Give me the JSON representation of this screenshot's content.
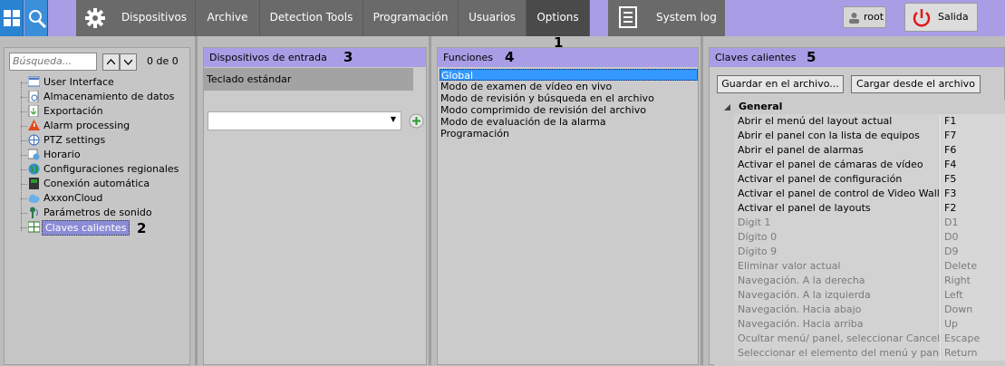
{
  "topbar": {
    "menu": [
      {
        "label": "Dispositivos",
        "active": false
      },
      {
        "label": "Archive",
        "active": false
      },
      {
        "label": "Detection Tools",
        "active": false
      },
      {
        "label": "Programación",
        "active": false
      },
      {
        "label": "Usuarios",
        "active": false
      },
      {
        "label": "Options",
        "active": true
      }
    ],
    "system_log": "System log",
    "user": "root",
    "exit": "Salida",
    "icons": [
      "layout-grid-icon",
      "search-icon",
      "gear-icon",
      "document-log-icon",
      "user-icon",
      "power-icon"
    ],
    "accent": "#a99de6"
  },
  "markers": [
    "1",
    "2",
    "3",
    "4",
    "5"
  ],
  "tree": {
    "search_placeholder": "Búsqueda...",
    "count": "0 de 0",
    "items": [
      {
        "label": "User Interface",
        "icon": "user-interface-icon"
      },
      {
        "label": "Almacenamiento de datos",
        "icon": "storage-icon"
      },
      {
        "label": "Exportación",
        "icon": "export-icon"
      },
      {
        "label": "Alarm processing",
        "icon": "alarm-icon"
      },
      {
        "label": "PTZ settings",
        "icon": "ptz-icon"
      },
      {
        "label": "Horario",
        "icon": "schedule-icon"
      },
      {
        "label": "Configuraciones regionales",
        "icon": "globe-icon"
      },
      {
        "label": "Conexión automática",
        "icon": "auto-connect-icon"
      },
      {
        "label": "AxxonCloud",
        "icon": "cloud-icon"
      },
      {
        "label": "Parámetros de sonido",
        "icon": "sound-icon"
      },
      {
        "label": "Claves calientes",
        "icon": "hotkeys-icon",
        "selected": true
      }
    ]
  },
  "devices": {
    "title": "Dispositivos de entrada",
    "item": "Teclado estándar",
    "select_value": ""
  },
  "functions": {
    "title": "Funciones",
    "items": [
      "Global",
      "Modo de examen de vídeo en vivo",
      "Modo de revisión y búsqueda en el archivo",
      "Modo comprimido de revisión del archivo",
      "Modo de evaluación de la alarma",
      "Programación"
    ]
  },
  "keys": {
    "title": "Claves calientes",
    "save_label": "Guardar en el archivo...",
    "load_label": "Cargar desde el archivo",
    "group": "General",
    "rows": [
      {
        "name": "Abrir el menú del layout actual",
        "key": "F1",
        "dim": false
      },
      {
        "name": "Abrir el panel con la lista de equipos",
        "key": "F7",
        "dim": false
      },
      {
        "name": "Abrir el panel de alarmas",
        "key": "F6",
        "dim": false
      },
      {
        "name": "Activar el panel de cámaras de vídeo",
        "key": "F4",
        "dim": false
      },
      {
        "name": "Activar el panel de configuración",
        "key": "F5",
        "dim": false
      },
      {
        "name": "Activar el panel de control de Video Wall",
        "key": "F3",
        "dim": false
      },
      {
        "name": "Activar el panel de layouts",
        "key": "F2",
        "dim": false
      },
      {
        "name": "Digit 1",
        "key": "D1",
        "dim": true
      },
      {
        "name": "Dígito 0",
        "key": "D0",
        "dim": true
      },
      {
        "name": "Dígito 9",
        "key": "D9",
        "dim": true
      },
      {
        "name": "Eliminar valor actual",
        "key": "Delete",
        "dim": true
      },
      {
        "name": "Navegación. A la derecha",
        "key": "Right",
        "dim": true
      },
      {
        "name": "Navegación. A la izquierda",
        "key": "Left",
        "dim": true
      },
      {
        "name": "Navegación. Hacia abajo",
        "key": "Down",
        "dim": true
      },
      {
        "name": "Navegación. Hacia arriba",
        "key": "Up",
        "dim": true
      },
      {
        "name": "Ocultar menú/ panel, seleccionar Cancelar",
        "key": "Escape",
        "dim": true
      },
      {
        "name": "Seleccionar el elemento del menú y panel",
        "key": "Return",
        "dim": true
      }
    ]
  }
}
